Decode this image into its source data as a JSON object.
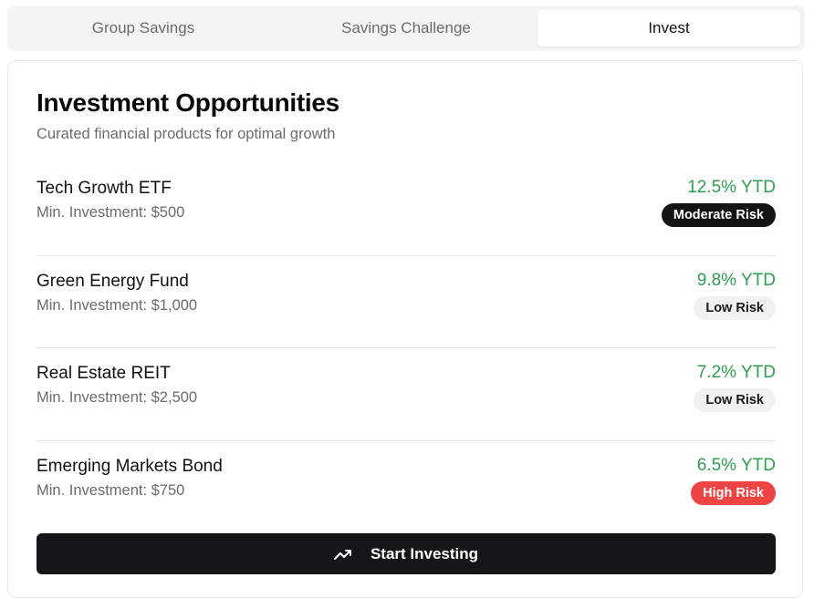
{
  "tabs": [
    {
      "label": "Group Savings",
      "active": false
    },
    {
      "label": "Savings Challenge",
      "active": false
    },
    {
      "label": "Invest",
      "active": true
    }
  ],
  "card": {
    "title": "Investment Opportunities",
    "subtitle": "Curated financial products for optimal growth"
  },
  "investments": [
    {
      "name": "Tech Growth ETF",
      "min": "Min. Investment: $500",
      "ytd": "12.5% YTD",
      "risk": "Moderate Risk"
    },
    {
      "name": "Green Energy Fund",
      "min": "Min. Investment: $1,000",
      "ytd": "9.8% YTD",
      "risk": "Low Risk"
    },
    {
      "name": "Real Estate REIT",
      "min": "Min. Investment: $2,500",
      "ytd": "7.2% YTD",
      "risk": "Low Risk"
    },
    {
      "name": "Emerging Markets Bond",
      "min": "Min. Investment: $750",
      "ytd": "6.5% YTD",
      "risk": "High Risk"
    }
  ],
  "cta": {
    "label": "Start Investing",
    "icon": "trending-up-icon"
  },
  "colors": {
    "positive": "#2e9e50",
    "moderate_risk": "#141414",
    "low_risk": "#f1f1f3",
    "high_risk": "#ef4444",
    "button": "#16161a"
  }
}
